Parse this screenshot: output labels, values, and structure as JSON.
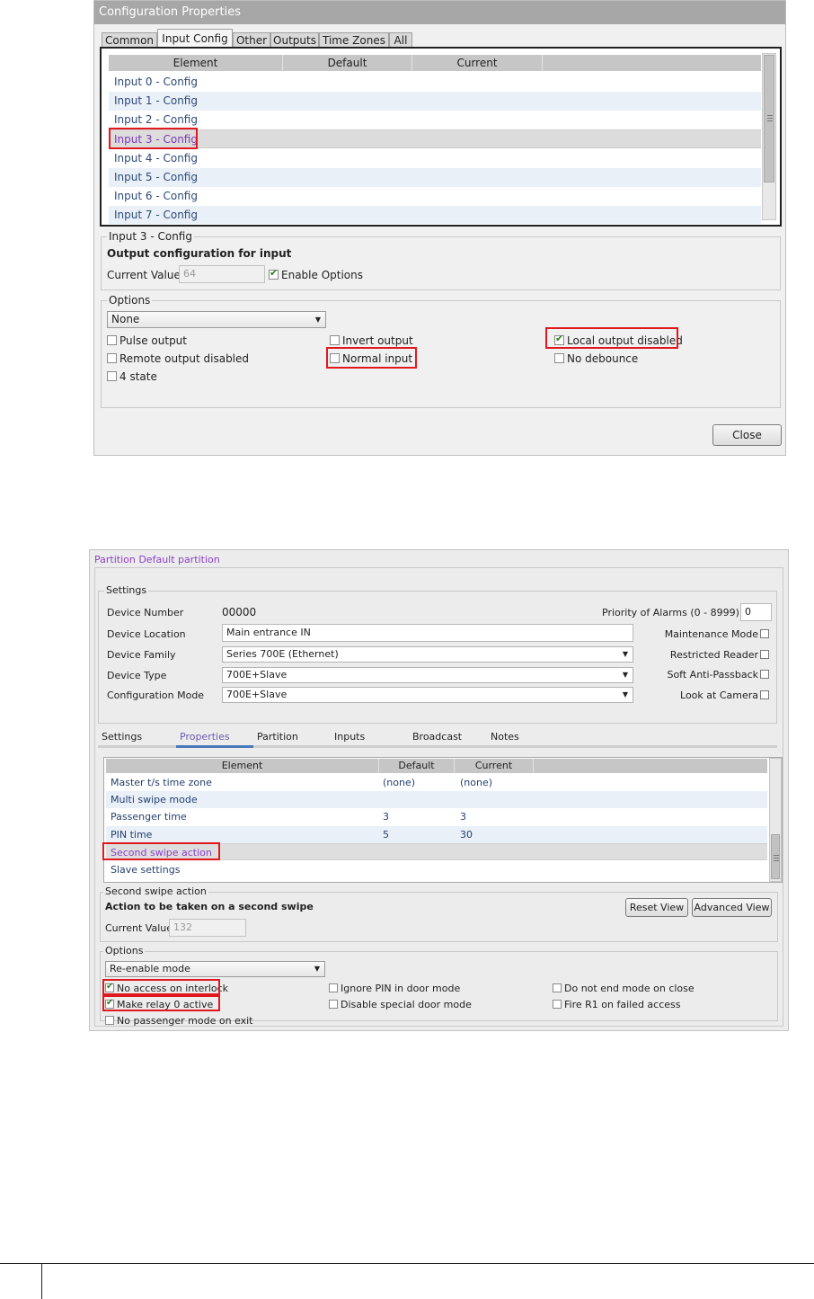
{
  "dialog1": {
    "title": "Configuration Properties",
    "tabs": [
      "Common",
      "Input Config",
      "Other",
      "Outputs",
      "Time Zones",
      "All"
    ],
    "active_tab": "Input Config",
    "grid": {
      "columns": [
        "Element",
        "Default",
        "Current"
      ],
      "rows": [
        "Input 0 - Config",
        "Input 1 - Config",
        "Input 2 - Config",
        "Input 3 - Config",
        "Input 4 - Config",
        "Input 5 - Config",
        "Input 6 - Config",
        "Input 7 - Config"
      ],
      "selected": "Input 3 - Config"
    },
    "detail": {
      "legend": "Input 3 - Config",
      "description": "Output configuration for input",
      "current_value_label": "Current Value",
      "current_value": "64",
      "enable_options_label": "Enable Options",
      "enable_options_checked": true
    },
    "options": {
      "legend": "Options",
      "combo_value": "None",
      "checkboxes": [
        {
          "label": "Pulse output",
          "checked": false
        },
        {
          "label": "Invert output",
          "checked": false
        },
        {
          "label": "Local output disabled",
          "checked": true
        },
        {
          "label": "Remote output disabled",
          "checked": false
        },
        {
          "label": "Normal input",
          "checked": false
        },
        {
          "label": "No debounce",
          "checked": false
        },
        {
          "label": "4 state",
          "checked": false
        }
      ]
    },
    "close_label": "Close"
  },
  "dialog2": {
    "breadcrumb": "Partition  Default partition",
    "settings": {
      "legend": "Settings",
      "device_number_label": "Device Number",
      "device_number": "00000",
      "device_location_label": "Device Location",
      "device_location": "Main entrance IN",
      "device_family_label": "Device Family",
      "device_family": "Series 700E (Ethernet)",
      "device_type_label": "Device Type",
      "device_type": "700E+Slave",
      "configuration_mode_label": "Configuration Mode",
      "configuration_mode": "700E+Slave",
      "priority_label": "Priority of Alarms (0 - 8999)",
      "priority_value": "0",
      "maintenance_mode_label": "Maintenance Mode",
      "restricted_reader_label": "Restricted Reader",
      "soft_anti_passback_label": "Soft Anti-Passback",
      "look_at_camera_label": "Look at Camera"
    },
    "tabs": [
      "Settings",
      "Properties",
      "Partition",
      "Inputs",
      "Broadcast",
      "Notes"
    ],
    "active_tab": "Properties",
    "grid": {
      "columns": [
        "Element",
        "Default",
        "Current"
      ],
      "rows": [
        {
          "element": "Master t/s time zone",
          "default": "(none)",
          "current": "(none)"
        },
        {
          "element": "Multi swipe mode",
          "default": "",
          "current": ""
        },
        {
          "element": "Passenger time",
          "default": "3",
          "current": "3"
        },
        {
          "element": "PIN time",
          "default": "5",
          "current": "30"
        },
        {
          "element": "Second swipe action",
          "default": "",
          "current": ""
        },
        {
          "element": "Slave settings",
          "default": "",
          "current": ""
        }
      ],
      "selected": "Second swipe action"
    },
    "detail": {
      "legend": "Second swipe action",
      "description": "Action to be taken on a second swipe",
      "current_value_label": "Current Value",
      "current_value": "132",
      "reset_view_label": "Reset View",
      "advanced_view_label": "Advanced View"
    },
    "options": {
      "legend": "Options",
      "combo_value": "Re-enable mode",
      "checkboxes": [
        {
          "label": "No access on interlock",
          "checked": true
        },
        {
          "label": "Ignore PIN in door mode",
          "checked": false
        },
        {
          "label": "Do not end mode on close",
          "checked": false
        },
        {
          "label": "Make relay 0 active",
          "checked": true
        },
        {
          "label": "Disable special door mode",
          "checked": false
        },
        {
          "label": "Fire R1 on failed access",
          "checked": false
        },
        {
          "label": "No passenger mode on exit",
          "checked": false
        }
      ]
    }
  },
  "colors": {
    "highlight_red": "#e0191f",
    "selection_purple": "#7b38b8",
    "check_green": "#2f7d21",
    "titlebar_gray": "#a7a7a7"
  }
}
